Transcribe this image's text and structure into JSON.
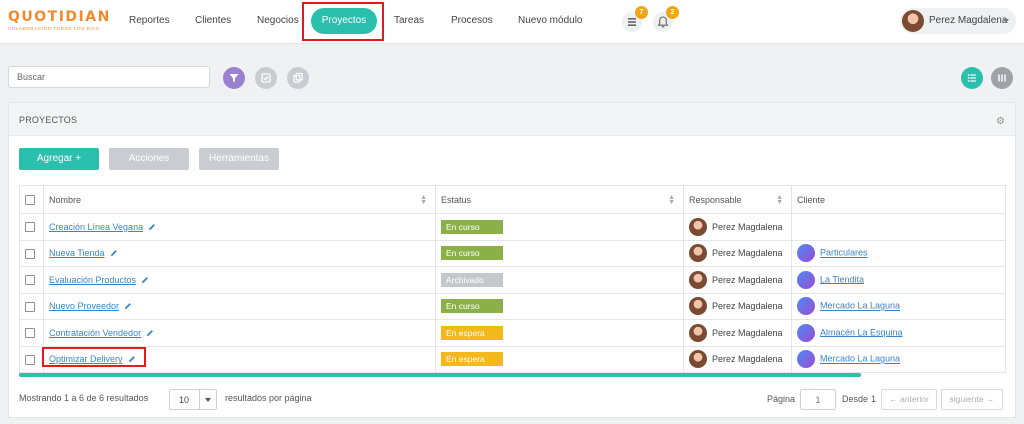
{
  "app": {
    "logo_text": "QUOTIDIAN",
    "logo_tagline": "COLABORACIÓN TODOS LOS DÍAS"
  },
  "nav": {
    "items": [
      "Reportes",
      "Clientes",
      "Negocios",
      "Proyectos",
      "Tareas",
      "Procesos",
      "Nuevo módulo"
    ],
    "active": "Proyectos",
    "tasks_badge": "7",
    "notifications_badge": "2",
    "user_name": "Perez Magdalena"
  },
  "search": {
    "placeholder": "Buscar"
  },
  "panel": {
    "title": "PROYECTOS",
    "buttons": {
      "add": "Agregar +",
      "actions": "Acciones",
      "tools": "Herramientas"
    }
  },
  "table": {
    "columns": [
      "Nombre",
      "Estatus",
      "Responsable",
      "Cliente"
    ],
    "rows": [
      {
        "name": "Creación Línea Vegana",
        "status": "En curso",
        "responsible": "Perez Magdalena",
        "client": ""
      },
      {
        "name": "Nueva Tienda",
        "status": "En curso",
        "responsible": "Perez Magdalena",
        "client": "Particulares"
      },
      {
        "name": "Evaluación Productos",
        "status": "Archivado",
        "responsible": "Perez Magdalena",
        "client": "La Tiendita"
      },
      {
        "name": "Nuevo Proveedor",
        "status": "En curso",
        "responsible": "Perez Magdalena",
        "client": "Mercado La Laguna"
      },
      {
        "name": "Contratación Vendedor",
        "status": "En espera",
        "responsible": "Perez Magdalena",
        "client": "Almacén La Esquina"
      },
      {
        "name": "Optimizar Delivery",
        "status": "En espera",
        "responsible": "Perez Magdalena",
        "client": "Mercado La Laguna"
      }
    ]
  },
  "status_colors": {
    "En curso": "#8cb048",
    "Archivado": "#c4c8cc",
    "En espera": "#f2b81c"
  },
  "colors": {
    "accent": "#2bbfae",
    "highlight": "#e41b1b",
    "filter": "#9b7fd1",
    "badge": "#f1a417"
  },
  "footer": {
    "showing": "Mostrando 1 a 6 de 6 resultados",
    "per_page_value": "10",
    "per_page_label": "resultados por página",
    "page_label": "Página",
    "page_value": "1",
    "from_label": "Desde",
    "from_value": "1",
    "prev": "← anterior",
    "next": "siguiente →"
  }
}
